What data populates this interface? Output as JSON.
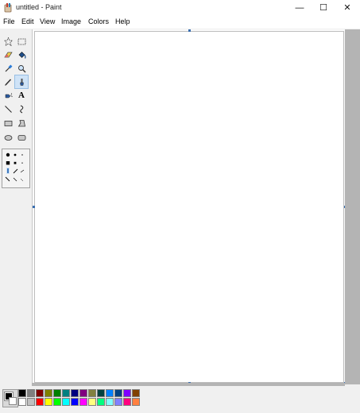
{
  "window": {
    "title": "untitled - Paint",
    "minimize_glyph": "—",
    "maximize_glyph": "☐",
    "close_glyph": "✕"
  },
  "menu": {
    "items": [
      "File",
      "Edit",
      "View",
      "Image",
      "Colors",
      "Help"
    ]
  },
  "tools": [
    {
      "name": "free-form-select",
      "icon": "star-select-icon"
    },
    {
      "name": "select",
      "icon": "rect-select-icon"
    },
    {
      "name": "eraser",
      "icon": "eraser-icon"
    },
    {
      "name": "fill-with-color",
      "icon": "bucket-icon"
    },
    {
      "name": "pick-color",
      "icon": "eyedropper-icon"
    },
    {
      "name": "magnifier",
      "icon": "magnifier-icon"
    },
    {
      "name": "pencil",
      "icon": "pencil-icon"
    },
    {
      "name": "brush",
      "icon": "brush-icon",
      "selected": true
    },
    {
      "name": "airbrush",
      "icon": "airbrush-icon"
    },
    {
      "name": "text",
      "icon": "text-icon",
      "glyph": "A"
    },
    {
      "name": "line",
      "icon": "line-icon"
    },
    {
      "name": "curve",
      "icon": "curve-icon"
    },
    {
      "name": "rectangle",
      "icon": "rectangle-icon"
    },
    {
      "name": "polygon",
      "icon": "polygon-icon"
    },
    {
      "name": "ellipse",
      "icon": "ellipse-icon"
    },
    {
      "name": "rounded-rectangle",
      "icon": "rounded-rect-icon"
    }
  ],
  "colors": {
    "accent_selected": "#cfe3f7",
    "foreground": "#000000",
    "background": "#ffffff",
    "palette_top": [
      "#000000",
      "#808080",
      "#800000",
      "#808000",
      "#008000",
      "#008080",
      "#000080",
      "#800080",
      "#808040",
      "#004040",
      "#0080ff",
      "#004080",
      "#8000ff",
      "#804000"
    ],
    "palette_bottom": [
      "#ffffff",
      "#c0c0c0",
      "#ff0000",
      "#ffff00",
      "#00ff00",
      "#00ffff",
      "#0000ff",
      "#ff00ff",
      "#ffff80",
      "#00ff80",
      "#80ffff",
      "#8080ff",
      "#ff0080",
      "#ff8040"
    ]
  }
}
